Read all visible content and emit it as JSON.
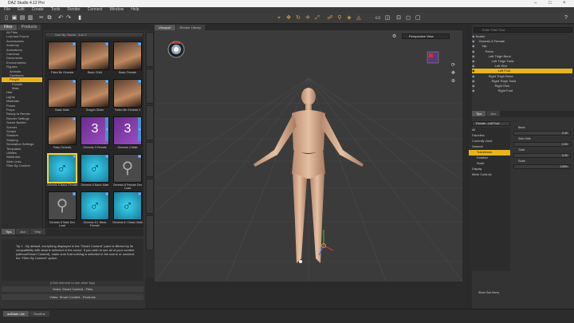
{
  "window": {
    "title": "DAZ Studio 4.12 Pro"
  },
  "menu": [
    "File",
    "Edit",
    "Create",
    "Tools",
    "Render",
    "Connect",
    "Window",
    "Help"
  ],
  "left_panel": {
    "tabs": [
      "Files",
      "Products"
    ],
    "search_placeholder": "Filter Files",
    "sort_label": "Sort By: Name - A to Z",
    "folders": [
      {
        "label": "All Files",
        "level": 0
      },
      {
        "label": "Lost and Found",
        "level": 0
      },
      {
        "label": "Accessories",
        "level": 0
      },
      {
        "label": "Anatomy",
        "level": 0
      },
      {
        "label": "Animations",
        "level": 0
      },
      {
        "label": "Cameras",
        "level": 0
      },
      {
        "label": "Documents",
        "level": 0
      },
      {
        "label": "Environments",
        "level": 0
      },
      {
        "label": "Figures",
        "level": 0
      },
      {
        "label": "Animals",
        "level": 1
      },
      {
        "label": "Creatures",
        "level": 1
      },
      {
        "label": "People",
        "level": 1,
        "selected": true
      },
      {
        "label": "Female",
        "level": 2
      },
      {
        "label": "Male",
        "level": 2
      },
      {
        "label": "Hair",
        "level": 0
      },
      {
        "label": "Lights",
        "level": 0
      },
      {
        "label": "Materials",
        "level": 0
      },
      {
        "label": "Poses",
        "level": 0
      },
      {
        "label": "Props",
        "level": 0
      },
      {
        "label": "Ready to Render",
        "level": 0
      },
      {
        "label": "Render Settings",
        "level": 0
      },
      {
        "label": "Scene Builder",
        "level": 0
      },
      {
        "label": "Scenes",
        "level": 0
      },
      {
        "label": "Scripts",
        "level": 0
      },
      {
        "label": "Shaders",
        "level": 0
      },
      {
        "label": "Shaping",
        "level": 0
      },
      {
        "label": "Simulation Settings",
        "level": 0
      },
      {
        "label": "Templates",
        "level": 0
      },
      {
        "label": "Utilities",
        "level": 0
      },
      {
        "label": "Wardrobe",
        "level": 0
      },
      {
        "label": "Web Links",
        "level": 0
      },
      {
        "label": "Filter By Context",
        "level": 0
      }
    ],
    "thumbs": [
      {
        "label": "Fitted Be Genesis",
        "style": "person"
      },
      {
        "label": "Basic Child",
        "style": "person"
      },
      {
        "label": "Basic Female",
        "style": "person"
      },
      {
        "label": "Basic Male",
        "style": "person"
      },
      {
        "label": "Dragon Glider",
        "style": "person"
      },
      {
        "label": "Fallen Be Genesis 3",
        "style": "person"
      },
      {
        "label": "Party Genesis",
        "style": "person"
      },
      {
        "label": "Genesis 3 Female",
        "style": "g3"
      },
      {
        "label": "Genesis 3 Male",
        "style": "g3"
      },
      {
        "label": "Genesis 8 Basic Female",
        "style": "cyan",
        "selected": true
      },
      {
        "label": "Genesis 8 Basic Male",
        "style": "cyan"
      },
      {
        "label": "Genesis 8 Female Dev Load",
        "style": "fig"
      },
      {
        "label": "Genesis 8 Male Dev Load",
        "style": "fig"
      },
      {
        "label": "Genesis 8.1 Basic Female",
        "style": "cyan"
      },
      {
        "label": "Genesis 8.1 Basic Male",
        "style": "cyan"
      }
    ],
    "bottom_tabs": [
      "Tips",
      "Aux",
      "Help"
    ],
    "tip_text": "Tip 1 - By default, everything displayed in the \"Smart Content\" pane is filtered by its compatibility with what is selected in the scene. If you wish to see all of your content (without/Smart Content), make sure that nothing is selected in the scene or uncheck the \"Filter By Context\" option.",
    "click_hint": "(Click element to see other tips)",
    "buttons": [
      "Video: Smart Content - Files",
      "Video: Smart Content - Products"
    ]
  },
  "viewport": {
    "tabs": [
      "Viewport",
      "Render Library"
    ],
    "view_label": "Perspective View",
    "side_tabs": [
      "Smart Content",
      "Content Library",
      "Scene",
      "Parameters",
      "Shaping",
      "Posing",
      "Render Settings"
    ]
  },
  "right_panel": {
    "search_placeholder": "Enter Filter Text",
    "scene_rows": [
      {
        "label": "Nodes",
        "indent": 0
      },
      {
        "label": "Genesis 8 Female",
        "indent": 1
      },
      {
        "label": "Hip",
        "indent": 2
      },
      {
        "label": "Pelvis",
        "indent": 3
      },
      {
        "label": "Left Thigh Bend",
        "indent": 4
      },
      {
        "label": "Left Thigh Twist",
        "indent": 5
      },
      {
        "label": "Left Shin",
        "indent": 6
      },
      {
        "label": "Left Foot",
        "indent": 7,
        "selected": true
      },
      {
        "label": "Right Thigh Bend",
        "indent": 4
      },
      {
        "label": "Right Thigh Twist",
        "indent": 5
      },
      {
        "label": "Right Shin",
        "indent": 6
      },
      {
        "label": "Right Foot",
        "indent": 7
      }
    ],
    "lower_tabs": [
      "Tips",
      "Aux"
    ],
    "node_label": "Female - Left Foot",
    "param_cats": [
      "All",
      "Favorites",
      "Currently Used",
      "General",
      "Transforms",
      "Rotation",
      "Scale",
      "Display",
      "Mesh Controls"
    ],
    "params": [
      {
        "label": "Bend",
        "value": "0.00"
      },
      {
        "label": "Side-Side",
        "value": "0.00"
      },
      {
        "label": "Twist",
        "value": "0.00"
      },
      {
        "label": "Scale",
        "value": "100%"
      }
    ],
    "show_sub_items": "Show Sub Items"
  },
  "bottom": {
    "tabs": [
      "aniMate Lite",
      "Timeline"
    ]
  },
  "colors": {
    "accent": "#e8b41e",
    "bg": "#2b2b2b",
    "viewport": "#3b3b3b"
  }
}
